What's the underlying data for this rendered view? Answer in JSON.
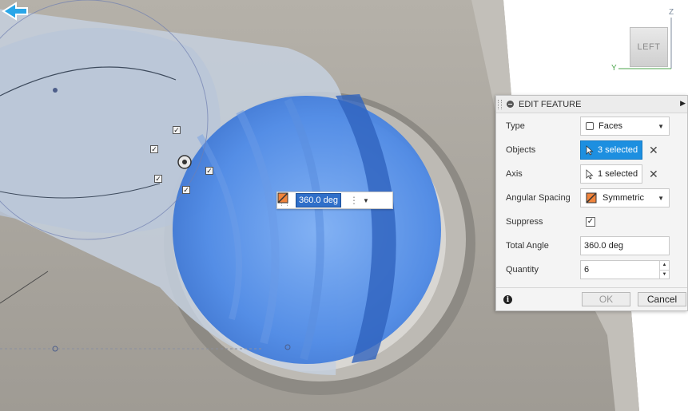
{
  "viewcube": {
    "face_label": "LEFT",
    "axis_z": "Z",
    "axis_y": "Y"
  },
  "canvas_input": {
    "value": "360.0 deg",
    "flip_icon": "flip-direction-icon"
  },
  "panel": {
    "title": "EDIT FEATURE",
    "rows": {
      "type": {
        "label": "Type",
        "value": "Faces"
      },
      "objects": {
        "label": "Objects",
        "value": "3 selected"
      },
      "axis": {
        "label": "Axis",
        "value": "1 selected"
      },
      "angular_spacing": {
        "label": "Angular Spacing",
        "value": "Symmetric"
      },
      "suppress": {
        "label": "Suppress",
        "checked": true
      },
      "total_angle": {
        "label": "Total Angle",
        "value": "360.0 deg"
      },
      "quantity": {
        "label": "Quantity",
        "value": "6"
      }
    },
    "buttons": {
      "ok": "OK",
      "cancel": "Cancel"
    }
  },
  "colors": {
    "accent_blue": "#1d8fe0",
    "selection_blue": "#3b7be0",
    "model_grey": "#a9a59e"
  }
}
